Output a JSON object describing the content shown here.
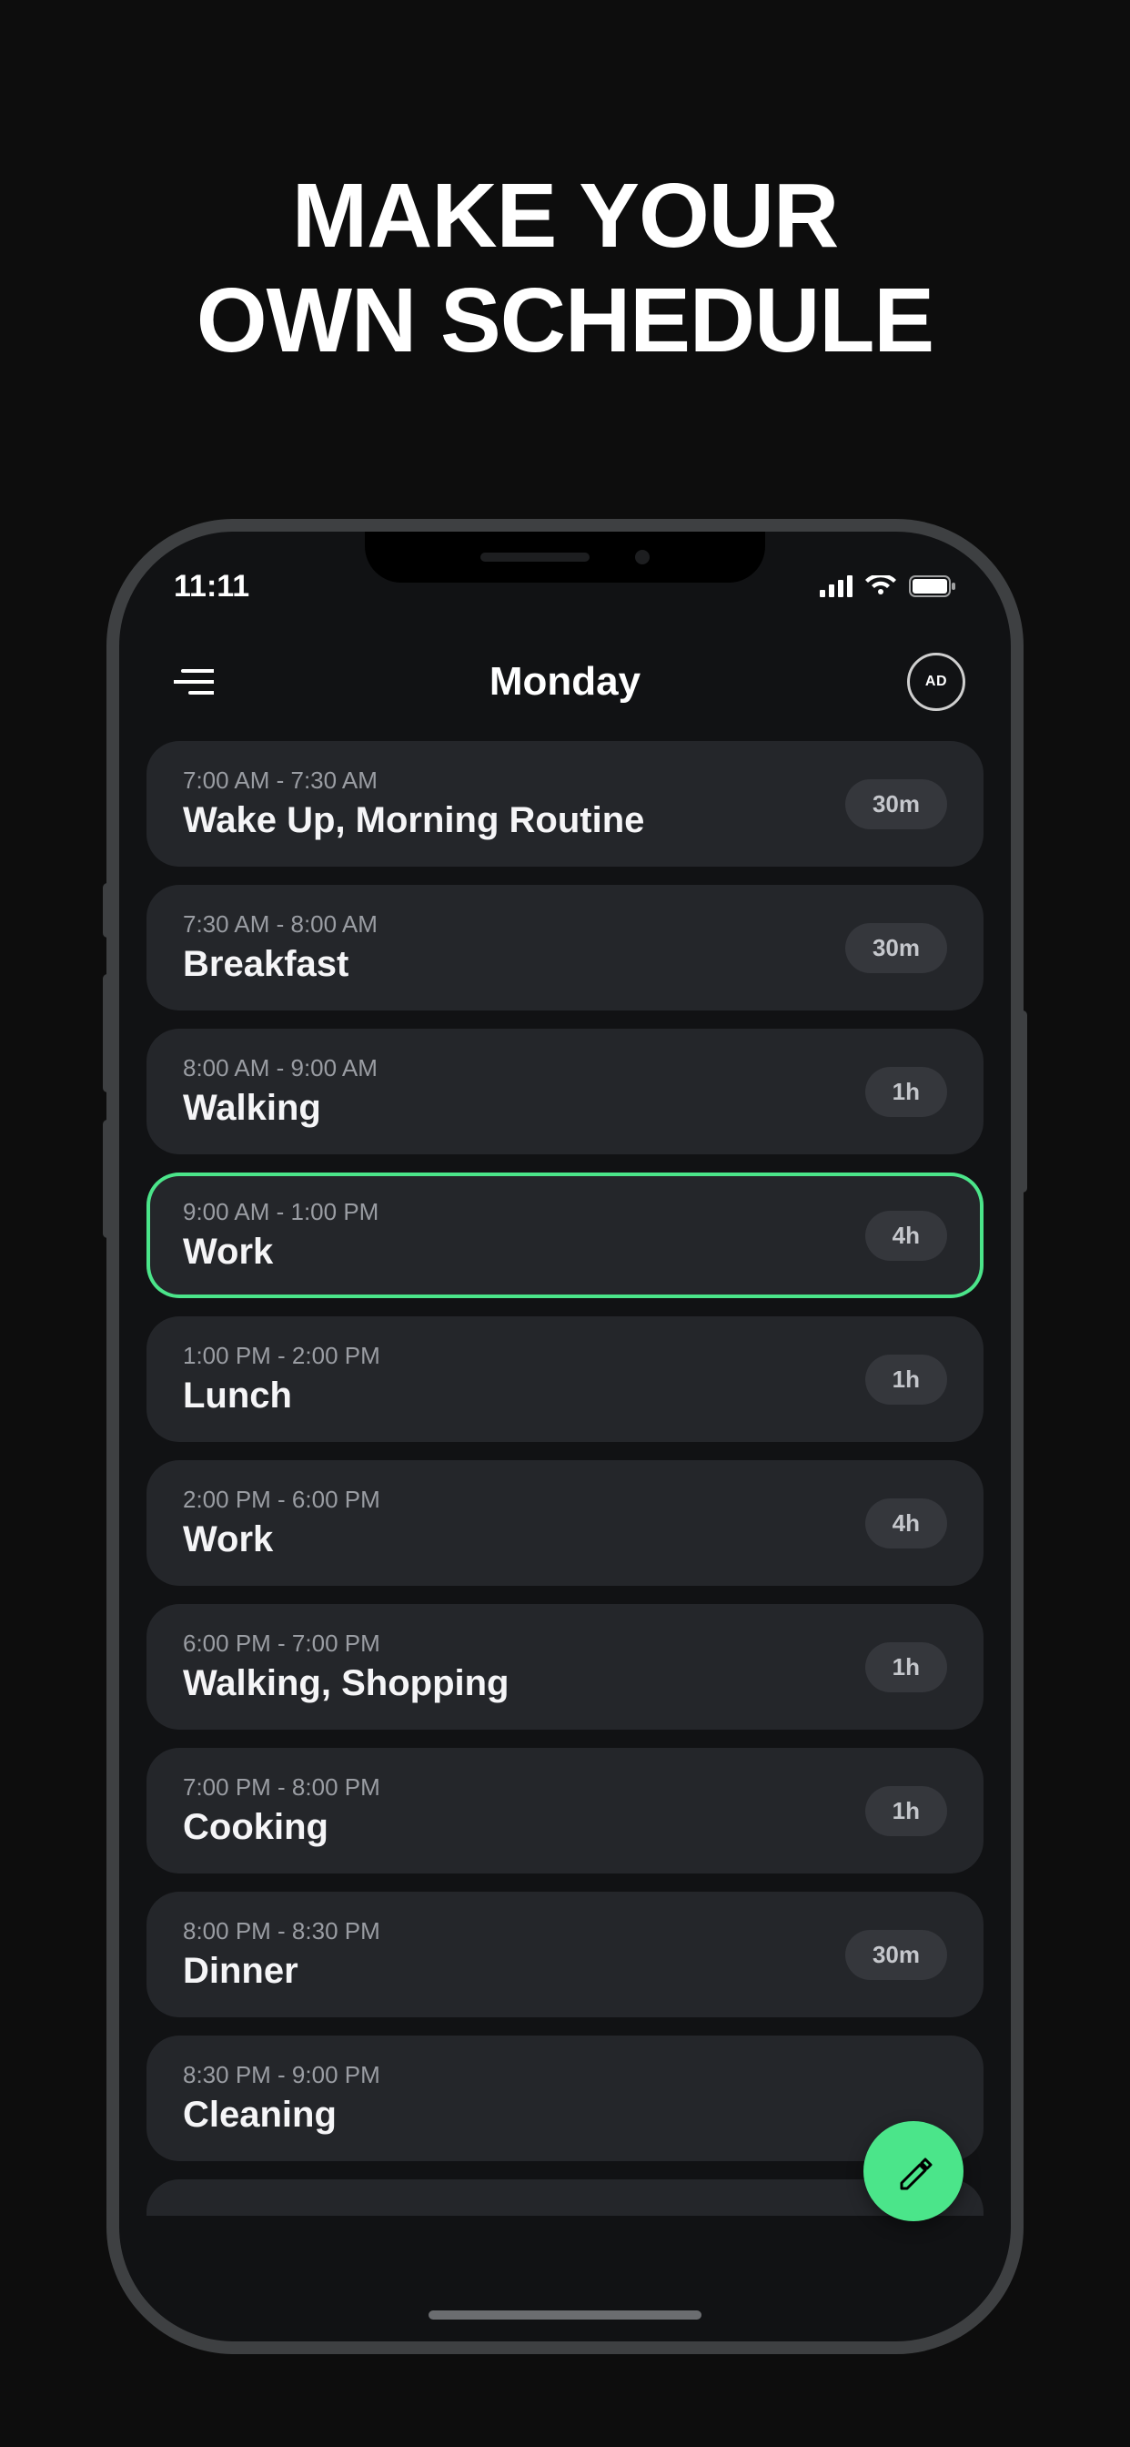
{
  "headline": {
    "line1": "MAKE YOUR",
    "line2": "OWN SCHEDULE"
  },
  "statusbar": {
    "time": "11:11"
  },
  "header": {
    "title": "Monday",
    "ad_label": "AD"
  },
  "schedule": [
    {
      "range": "7:00 AM - 7:30 AM",
      "title": "Wake Up, Morning Routine",
      "duration": "30m",
      "highlight": false
    },
    {
      "range": "7:30 AM - 8:00 AM",
      "title": "Breakfast",
      "duration": "30m",
      "highlight": false
    },
    {
      "range": "8:00 AM - 9:00 AM",
      "title": "Walking",
      "duration": "1h",
      "highlight": false
    },
    {
      "range": "9:00 AM - 1:00 PM",
      "title": "Work",
      "duration": "4h",
      "highlight": true
    },
    {
      "range": "1:00 PM - 2:00 PM",
      "title": "Lunch",
      "duration": "1h",
      "highlight": false
    },
    {
      "range": "2:00 PM - 6:00 PM",
      "title": "Work",
      "duration": "4h",
      "highlight": false
    },
    {
      "range": "6:00 PM - 7:00 PM",
      "title": "Walking, Shopping",
      "duration": "1h",
      "highlight": false
    },
    {
      "range": "7:00 PM - 8:00 PM",
      "title": "Cooking",
      "duration": "1h",
      "highlight": false
    },
    {
      "range": "8:00 PM - 8:30 PM",
      "title": "Dinner",
      "duration": "30m",
      "highlight": false
    },
    {
      "range": "8:30 PM - 9:00 PM",
      "title": "Cleaning",
      "duration": "",
      "highlight": false
    }
  ],
  "accent": "#4be58a"
}
